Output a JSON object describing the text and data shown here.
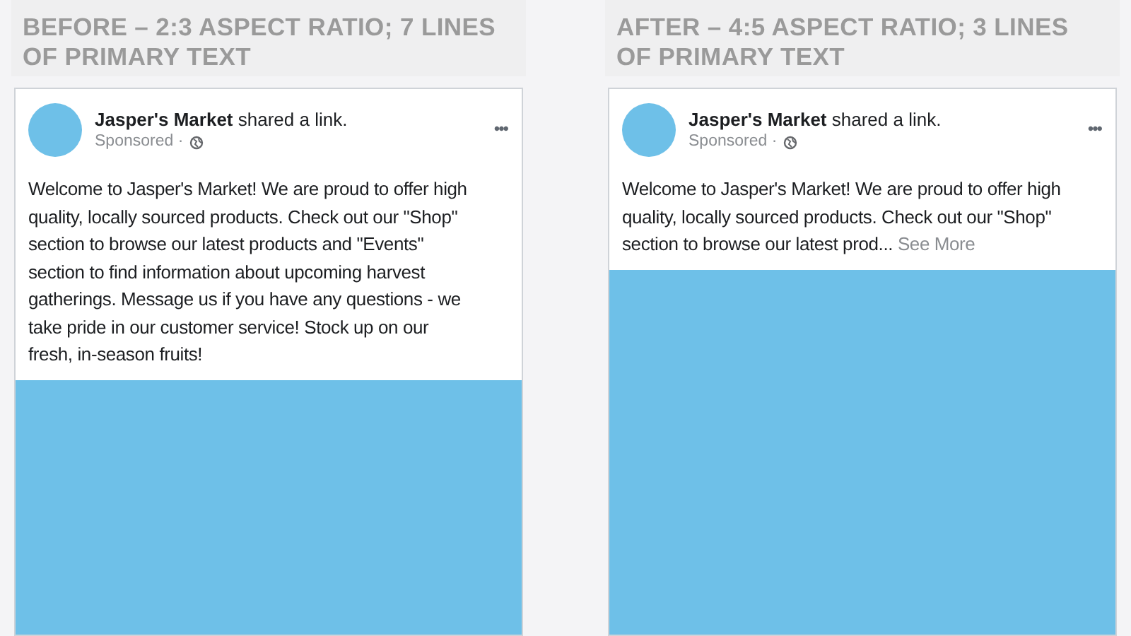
{
  "panels": [
    {
      "heading": "BEFORE – 2:3 ASPECT RATIO; 7 LINES OF PRIMARY TEXT",
      "post": {
        "page_name": "Jasper's Market",
        "action": "shared a link.",
        "sponsored": "Sponsored",
        "separator": "·",
        "menu": "•••",
        "text": "Welcome to Jasper's Market! We are proud to offer high quality, locally sourced products. Check out our \"Shop\" section to browse our latest products and \"Events\" section to find information about upcoming harvest gatherings. Message us if you have any questions - we take pride in our customer service! Stock up on our fresh, in-season fruits!"
      }
    },
    {
      "heading": "AFTER – 4:5 ASPECT RATIO; 3 LINES OF PRIMARY TEXT",
      "post": {
        "page_name": "Jasper's Market",
        "action": "shared a link.",
        "sponsored": "Sponsored",
        "separator": "·",
        "menu": "•••",
        "text": "Welcome to Jasper's Market! We are proud to offer high quality, locally sourced products. Check out our \"Shop\" section to browse our latest prod...",
        "see_more": "See More"
      }
    }
  ]
}
